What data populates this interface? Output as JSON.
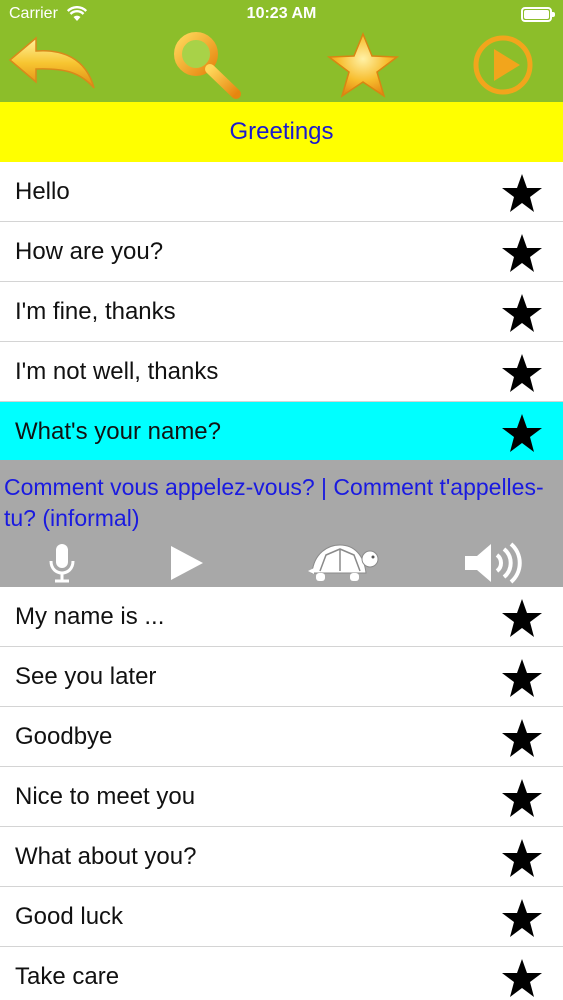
{
  "status_bar": {
    "carrier": "Carrier",
    "time": "10:23 AM"
  },
  "toolbar": {
    "back_icon": "back-arrow-icon",
    "search_icon": "magnifier-icon",
    "favorites_icon": "star-icon",
    "play_icon": "play-circle-icon",
    "colors": {
      "background": "#8cbe2a",
      "icon_gold": "#f2b01e"
    }
  },
  "section": {
    "title": "Greetings",
    "background": "#ffff00",
    "text_color": "#1a1ad0"
  },
  "phrases_top": [
    {
      "label": "Hello"
    },
    {
      "label": "How are you?"
    },
    {
      "label": "I'm fine, thanks"
    },
    {
      "label": "I'm not well, thanks"
    },
    {
      "label": "What's your name?",
      "selected": true
    }
  ],
  "translation": {
    "text": "Comment vous appelez-vous? | Comment t'appelles-tu? (informal)",
    "controls": [
      "microphone-icon",
      "play-icon",
      "turtle-icon",
      "speaker-icon"
    ],
    "background": "#a8a8a8",
    "text_color": "#1a1ae0"
  },
  "phrases_bottom": [
    {
      "label": "My name is ..."
    },
    {
      "label": "See you later"
    },
    {
      "label": "Goodbye"
    },
    {
      "label": "Nice to meet you"
    },
    {
      "label": "What about you?"
    },
    {
      "label": "Good luck"
    },
    {
      "label": "Take care"
    }
  ],
  "selected_row_color": "#00ffff"
}
